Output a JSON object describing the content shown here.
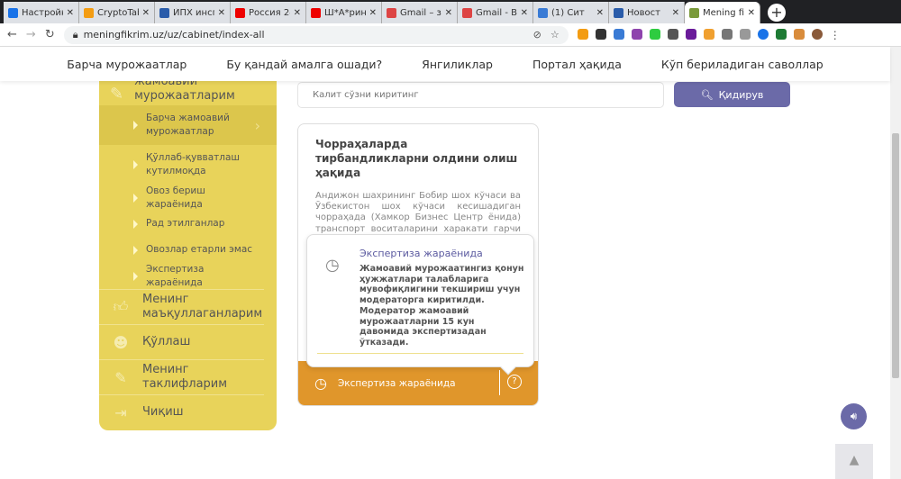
{
  "browser": {
    "tabs": [
      {
        "title": "Настройки",
        "color": "#1a73e8"
      },
      {
        "title": "CryptoTab",
        "color": "#f39c12"
      },
      {
        "title": "ЙПХ инсп",
        "color": "#2a5caa"
      },
      {
        "title": "Россия 24",
        "color": "#e00"
      },
      {
        "title": "Ш*А*рин",
        "color": "#e00"
      },
      {
        "title": "Gmail – з",
        "color": "#d44"
      },
      {
        "title": "Gmail - В",
        "color": "#d44"
      },
      {
        "title": "(1) Сит",
        "color": "#3a7bd5"
      },
      {
        "title": "Новост",
        "color": "#2a5caa"
      },
      {
        "title": "Mening fi",
        "color": "#7a9a3a",
        "active": true
      }
    ],
    "url": "meningfikrim.uz/uz/cabinet/index-all"
  },
  "nav": [
    "Барча мурожаатлар",
    "Бу қандай амалга ошади?",
    "Янгиликлар",
    "Портал ҳақида",
    "Кўп бериладиган саволлар"
  ],
  "sidebar": {
    "header": "Менинг жамоавий мурожаатларим",
    "sub_items": [
      "Барча жамоавий мурожаатлар",
      "Қўллаб-қувватлаш кутилмоқда",
      "Овоз бериш жараёнида",
      "Рад этилганлар",
      "Овозлар етарли эмас",
      "Экспертиза жараёнида"
    ],
    "items": [
      {
        "label": "Менинг маъқуллаганларим",
        "icon": "thumbs-up-icon"
      },
      {
        "label": "Қўллаш",
        "icon": "support-icon"
      },
      {
        "label": "Менинг таклифларим",
        "icon": "pen-icon"
      },
      {
        "label": "Чиқиш",
        "icon": "logout-icon"
      }
    ]
  },
  "search": {
    "placeholder": "Калит сўзни киритинг",
    "button": "Қидирув"
  },
  "card": {
    "title": "Чорраҳаларда тирбандликларни олдини олиш ҳақида",
    "text": "Андижон шахрининг Бобир шох кўчаси ва Ўзбекистон шох кўчаси кесишадиган чорраҳада (Хамкор Бизнес Центр ёнида) транспорт воситаларини харакати гарчи бу чорраха светофор ёрдамида бошқарилаётган бўлсада кўп холларда автотранспорт воситаларининг",
    "status": "Экспертиза жараёнида"
  },
  "popup": {
    "title": "Экспертиза жараёнида",
    "text": "Жамоавий мурожаатингиз қонун ҳужжатлари талабларига мувофиқлигини текшириш учун модераторга киритилди. Модератор жамоавий мурожаатларни 15 кун давомида экспертизадан ўтказади."
  },
  "colors": {
    "sidebar": "#e8d35a",
    "accent": "#6b6aa8",
    "status": "#e0962b"
  }
}
